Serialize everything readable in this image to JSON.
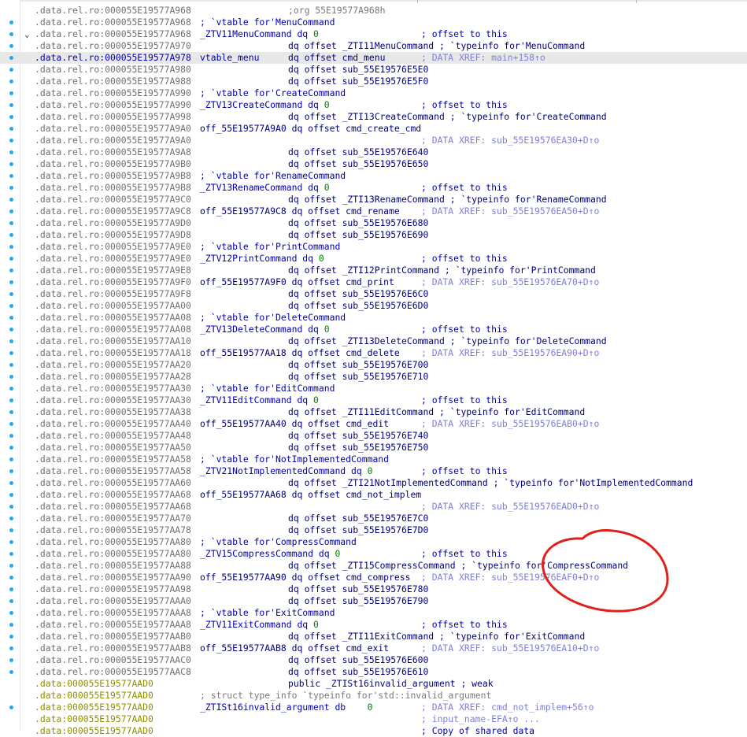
{
  "segment_prefix": ".data.rel.ro:",
  "data_prefix": ".data:",
  "rows": [
    {
      "addr": "000055E19577A968",
      "seg": "rel",
      "c1": "",
      "c1cls": "",
      "c2": ";org 55E19577A968h",
      "c2cls": "org",
      "c2pos": "366",
      "c3": "",
      "c3cls": "",
      "dot": false
    },
    {
      "addr": "000055E19577A968",
      "seg": "rel",
      "c1": "; `vtable for'MenuCommand",
      "c1cls": "cmt",
      "dot": true
    },
    {
      "addr": "000055E19577A968",
      "seg": "rel",
      "c1": "_ZTV11MenuCommand dq ",
      "c1cls": "lbl",
      "num": "0",
      "c3": "; offset to this",
      "c3cls": "cmt",
      "dot": true,
      "chev": true
    },
    {
      "addr": "000055E19577A970",
      "seg": "rel",
      "c2": "dq offset _ZTI11MenuCommand ; `typeinfo for'MenuCommand",
      "c2cls": "mix",
      "dot": true
    },
    {
      "addr": "000055E19577A978",
      "seg": "rel",
      "c1": "vtable_menu",
      "c1cls": "lbl",
      "c2": "dq offset cmd_menu",
      "c2cls": "kw",
      "c3": "; DATA XREF: main+158↑o",
      "c3cls": "xref",
      "dot": true,
      "hl": true
    },
    {
      "addr": "000055E19577A980",
      "seg": "rel",
      "c2": "dq offset sub_55E19576E5E0",
      "c2cls": "kw",
      "dot": true
    },
    {
      "addr": "000055E19577A988",
      "seg": "rel",
      "c2": "dq offset sub_55E19576E5F0",
      "c2cls": "kw",
      "dot": true
    },
    {
      "addr": "000055E19577A990",
      "seg": "rel",
      "c1": "; `vtable for'CreateCommand",
      "c1cls": "cmt",
      "dot": true
    },
    {
      "addr": "000055E19577A990",
      "seg": "rel",
      "c1": "_ZTV13CreateCommand dq ",
      "c1cls": "lbl",
      "num": "0",
      "c3": "; offset to this",
      "c3cls": "cmt",
      "dot": true
    },
    {
      "addr": "000055E19577A998",
      "seg": "rel",
      "c2": "dq offset _ZTI13CreateCommand ; `typeinfo for'CreateCommand",
      "c2cls": "mix",
      "dot": true
    },
    {
      "addr": "000055E19577A9A0",
      "seg": "rel",
      "c1": "off_55E19577A9A0 dq offset cmd_create_cmd",
      "c1cls": "kw",
      "dot": true
    },
    {
      "addr": "000055E19577A9A0",
      "seg": "rel",
      "c3": "; DATA XREF: sub_55E19576EA30+D↑o",
      "c3cls": "xref",
      "dot": true
    },
    {
      "addr": "000055E19577A9A8",
      "seg": "rel",
      "c2": "dq offset sub_55E19576E640",
      "c2cls": "kw",
      "dot": true
    },
    {
      "addr": "000055E19577A9B0",
      "seg": "rel",
      "c2": "dq offset sub_55E19576E650",
      "c2cls": "kw",
      "dot": true
    },
    {
      "addr": "000055E19577A9B8",
      "seg": "rel",
      "c1": "; `vtable for'RenameCommand",
      "c1cls": "cmt",
      "dot": true
    },
    {
      "addr": "000055E19577A9B8",
      "seg": "rel",
      "c1": "_ZTV13RenameCommand dq ",
      "c1cls": "lbl",
      "num": "0",
      "c3": "; offset to this",
      "c3cls": "cmt",
      "dot": true
    },
    {
      "addr": "000055E19577A9C0",
      "seg": "rel",
      "c2": "dq offset _ZTI13RenameCommand ; `typeinfo for'RenameCommand",
      "c2cls": "mix",
      "dot": true
    },
    {
      "addr": "000055E19577A9C8",
      "seg": "rel",
      "c1": "off_55E19577A9C8 dq offset cmd_rename",
      "c1cls": "kw",
      "c3": "; DATA XREF: sub_55E19576EA50+D↑o",
      "c3cls": "xref",
      "dot": true
    },
    {
      "addr": "000055E19577A9D0",
      "seg": "rel",
      "c2": "dq offset sub_55E19576E680",
      "c2cls": "kw",
      "dot": true
    },
    {
      "addr": "000055E19577A9D8",
      "seg": "rel",
      "c2": "dq offset sub_55E19576E690",
      "c2cls": "kw",
      "dot": true
    },
    {
      "addr": "000055E19577A9E0",
      "seg": "rel",
      "c1": "; `vtable for'PrintCommand",
      "c1cls": "cmt",
      "dot": true
    },
    {
      "addr": "000055E19577A9E0",
      "seg": "rel",
      "c1": "_ZTV12PrintCommand dq ",
      "c1cls": "lbl",
      "num": "0",
      "c3": "; offset to this",
      "c3cls": "cmt",
      "dot": true
    },
    {
      "addr": "000055E19577A9E8",
      "seg": "rel",
      "c2": "dq offset _ZTI12PrintCommand ; `typeinfo for'PrintCommand",
      "c2cls": "mix",
      "dot": true
    },
    {
      "addr": "000055E19577A9F0",
      "seg": "rel",
      "c1": "off_55E19577A9F0 dq offset cmd_print",
      "c1cls": "kw",
      "c3": "; DATA XREF: sub_55E19576EA70+D↑o",
      "c3cls": "xref",
      "dot": true
    },
    {
      "addr": "000055E19577A9F8",
      "seg": "rel",
      "c2": "dq offset sub_55E19576E6C0",
      "c2cls": "kw",
      "dot": true
    },
    {
      "addr": "000055E19577AA00",
      "seg": "rel",
      "c2": "dq offset sub_55E19576E6D0",
      "c2cls": "kw",
      "dot": true
    },
    {
      "addr": "000055E19577AA08",
      "seg": "rel",
      "c1": "; `vtable for'DeleteCommand",
      "c1cls": "cmt",
      "dot": true
    },
    {
      "addr": "000055E19577AA08",
      "seg": "rel",
      "c1": "_ZTV13DeleteCommand dq ",
      "c1cls": "lbl",
      "num": "0",
      "c3": "; offset to this",
      "c3cls": "cmt",
      "dot": true
    },
    {
      "addr": "000055E19577AA10",
      "seg": "rel",
      "c2": "dq offset _ZTI13DeleteCommand ; `typeinfo for'DeleteCommand",
      "c2cls": "mix",
      "dot": true
    },
    {
      "addr": "000055E19577AA18",
      "seg": "rel",
      "c1": "off_55E19577AA18 dq offset cmd_delete",
      "c1cls": "kw",
      "c3": "; DATA XREF: sub_55E19576EA90+D↑o",
      "c3cls": "xref",
      "dot": true
    },
    {
      "addr": "000055E19577AA20",
      "seg": "rel",
      "c2": "dq offset sub_55E19576E700",
      "c2cls": "kw",
      "dot": true
    },
    {
      "addr": "000055E19577AA28",
      "seg": "rel",
      "c2": "dq offset sub_55E19576E710",
      "c2cls": "kw",
      "dot": true
    },
    {
      "addr": "000055E19577AA30",
      "seg": "rel",
      "c1": "; `vtable for'EditCommand",
      "c1cls": "cmt",
      "dot": true
    },
    {
      "addr": "000055E19577AA30",
      "seg": "rel",
      "c1": "_ZTV11EditCommand dq ",
      "c1cls": "lbl",
      "num": "0",
      "c3": "; offset to this",
      "c3cls": "cmt",
      "dot": true
    },
    {
      "addr": "000055E19577AA38",
      "seg": "rel",
      "c2": "dq offset _ZTI11EditCommand ; `typeinfo for'EditCommand",
      "c2cls": "mix",
      "dot": true
    },
    {
      "addr": "000055E19577AA40",
      "seg": "rel",
      "c1": "off_55E19577AA40 dq offset cmd_edit",
      "c1cls": "kw",
      "c3": "; DATA XREF: sub_55E19576EAB0+D↑o",
      "c3cls": "xref",
      "dot": true
    },
    {
      "addr": "000055E19577AA48",
      "seg": "rel",
      "c2": "dq offset sub_55E19576E740",
      "c2cls": "kw",
      "dot": true
    },
    {
      "addr": "000055E19577AA50",
      "seg": "rel",
      "c2": "dq offset sub_55E19576E750",
      "c2cls": "kw",
      "dot": true
    },
    {
      "addr": "000055E19577AA58",
      "seg": "rel",
      "c1": "; `vtable for'NotImplementedCommand",
      "c1cls": "cmt",
      "dot": true
    },
    {
      "addr": "000055E19577AA58",
      "seg": "rel",
      "c1": "_ZTV21NotImplementedCommand dq ",
      "c1cls": "lbl",
      "num": "0",
      "c3": "; offset to this",
      "c3cls": "cmt",
      "dot": true
    },
    {
      "addr": "000055E19577AA60",
      "seg": "rel",
      "c2": "dq offset _ZTI21NotImplementedCommand ; `typeinfo for'NotImplementedCommand",
      "c2cls": "mix",
      "dot": true
    },
    {
      "addr": "000055E19577AA68",
      "seg": "rel",
      "c1": "off_55E19577AA68 dq offset cmd_not_implem",
      "c1cls": "kw",
      "dot": true
    },
    {
      "addr": "000055E19577AA68",
      "seg": "rel",
      "c3": "; DATA XREF: sub_55E19576EAD0+D↑o",
      "c3cls": "xref",
      "dot": true
    },
    {
      "addr": "000055E19577AA70",
      "seg": "rel",
      "c2": "dq offset sub_55E19576E7C0",
      "c2cls": "kw",
      "dot": true
    },
    {
      "addr": "000055E19577AA78",
      "seg": "rel",
      "c2": "dq offset sub_55E19576E7D0",
      "c2cls": "kw",
      "dot": true
    },
    {
      "addr": "000055E19577AA80",
      "seg": "rel",
      "c1": "; `vtable for'CompressCommand",
      "c1cls": "cmt",
      "dot": true
    },
    {
      "addr": "000055E19577AA80",
      "seg": "rel",
      "c1": "_ZTV15CompressCommand dq ",
      "c1cls": "lbl",
      "num": "0",
      "c3": "; offset to this",
      "c3cls": "cmt",
      "dot": true
    },
    {
      "addr": "000055E19577AA88",
      "seg": "rel",
      "c2": "dq offset _ZTI15CompressCommand ; `typeinfo for'CompressCommand",
      "c2cls": "mix",
      "dot": true
    },
    {
      "addr": "000055E19577AA90",
      "seg": "rel",
      "c1": "off_55E19577AA90 dq offset cmd_compress",
      "c1cls": "kw",
      "c3": "; DATA XREF: sub_55E19576EAF0+D↑o",
      "c3cls": "xref",
      "dot": true
    },
    {
      "addr": "000055E19577AA98",
      "seg": "rel",
      "c2": "dq offset sub_55E19576E780",
      "c2cls": "kw",
      "dot": true
    },
    {
      "addr": "000055E19577AAA0",
      "seg": "rel",
      "c2": "dq offset sub_55E19576E790",
      "c2cls": "kw",
      "dot": true
    },
    {
      "addr": "000055E19577AAA8",
      "seg": "rel",
      "c1": "; `vtable for'ExitCommand",
      "c1cls": "cmt",
      "dot": true
    },
    {
      "addr": "000055E19577AAA8",
      "seg": "rel",
      "c1": "_ZTV11ExitCommand dq ",
      "c1cls": "lbl",
      "num": "0",
      "c3": "; offset to this",
      "c3cls": "cmt",
      "dot": true
    },
    {
      "addr": "000055E19577AAB0",
      "seg": "rel",
      "c2": "dq offset _ZTI11ExitCommand ; `typeinfo for'ExitCommand",
      "c2cls": "mix",
      "dot": true
    },
    {
      "addr": "000055E19577AAB8",
      "seg": "rel",
      "c1": "off_55E19577AAB8 dq offset cmd_exit",
      "c1cls": "kw",
      "c3": "; DATA XREF: sub_55E19576EA10+D↑o",
      "c3cls": "xref",
      "dot": true
    },
    {
      "addr": "000055E19577AAC0",
      "seg": "rel",
      "c2": "dq offset sub_55E19576E600",
      "c2cls": "kw",
      "dot": true
    },
    {
      "addr": "000055E19577AAC8",
      "seg": "rel",
      "c2": "dq offset sub_55E19576E610",
      "c2cls": "kw",
      "dot": true
    },
    {
      "addr": "000055E19577AAD0",
      "seg": "data",
      "c2": "public _ZTISt16invalid_argument ; weak",
      "c2cls": "mixw",
      "dot": false
    },
    {
      "addr": "000055E19577AAD0",
      "seg": "data",
      "c1": "; struct type_info `typeinfo for'std::invalid_argument",
      "c1cls": "mut",
      "dot": false
    },
    {
      "addr": "000055E19577AAD0",
      "seg": "data",
      "c1": "_ZTISt16invalid_argument db    ",
      "c1cls": "lbl",
      "num": "0",
      "c3": "; DATA XREF: cmd_not_implem+56↑o",
      "c3cls": "xref",
      "dot": true
    },
    {
      "addr": "000055E19577AAD0",
      "seg": "data",
      "c3": "; input_name-EFA↑o ...",
      "c3cls": "xref",
      "dot": false
    },
    {
      "addr": "000055E19577AAD0",
      "seg": "data",
      "c3": "; Copy of shared data",
      "c3cls": "cmt",
      "dot": false
    }
  ],
  "colors": {
    "xref": "#7f7fdc",
    "label": "#0000b0",
    "segment_data": "#8f8f00",
    "dot": "#2aa7e6",
    "annotation": "#e0201c"
  }
}
